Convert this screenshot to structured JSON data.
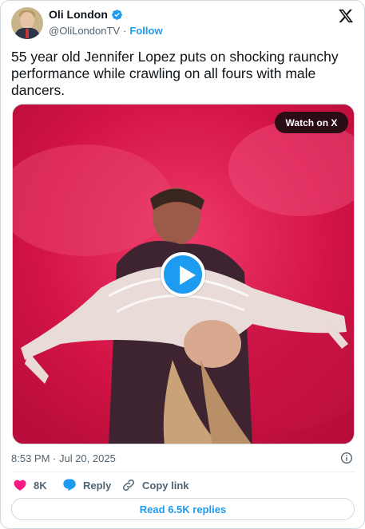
{
  "author": {
    "display_name": "Oli London",
    "handle": "@OliLondonTV",
    "separator": "·",
    "follow_label": "Follow",
    "verified_color": "#1d9bf0"
  },
  "tweet": {
    "text": "55 year old Jennifer Lopez puts on shocking raunchy performance while crawling on all fours with male dancers.",
    "timestamp": "8:53 PM · Jul 20, 2025"
  },
  "media": {
    "watch_label": "Watch on X",
    "play_icon": "play-icon",
    "background_color": "#d8174a"
  },
  "actions": {
    "like_count": "8K",
    "reply_label": "Reply",
    "copy_link_label": "Copy link"
  },
  "footer": {
    "read_replies_label": "Read 6.5K replies"
  },
  "colors": {
    "accent": "#1d9bf0",
    "like": "#f91880",
    "text_secondary": "#536471"
  }
}
